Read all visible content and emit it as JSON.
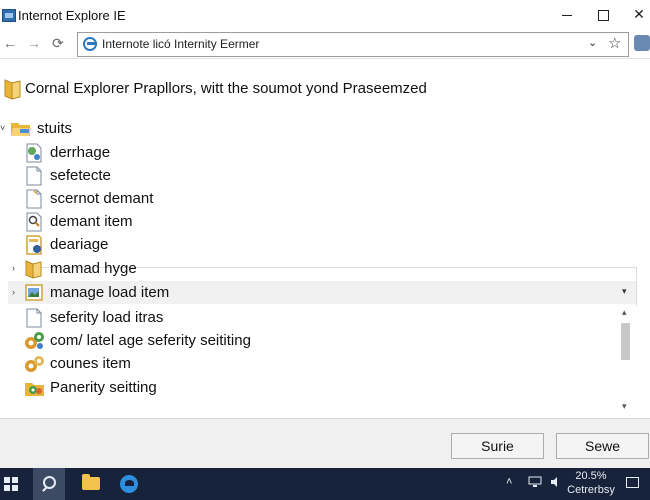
{
  "window": {
    "title": "Internot Explore IE",
    "controls": {
      "minimize": "minimize-icon",
      "maximize": "maximize-icon",
      "close": "close-icon"
    }
  },
  "address_bar": {
    "back": "←",
    "forward": "→",
    "refresh": "⟳",
    "url": "Internote licó Internity Eermer",
    "dropdown": "⌄",
    "favorite": "☆"
  },
  "header": {
    "text": "Cornal Explorer Prapllors, witt the soumot yond Praseemzed"
  },
  "tree": {
    "root": {
      "label": "stuits",
      "expander": "˅"
    },
    "items": [
      {
        "label": "derrhage",
        "icon": "settings-file-icon"
      },
      {
        "label": "sefetecte",
        "icon": "document-icon"
      },
      {
        "label": "scernot demant",
        "icon": "document-icon"
      },
      {
        "label": "demant item",
        "icon": "search-document-icon"
      },
      {
        "label": "deariage",
        "icon": "shield-document-icon"
      },
      {
        "label": "mamad hyge",
        "icon": "folder-icon",
        "expander": "›"
      },
      {
        "label": "manage load item",
        "icon": "image-document-icon",
        "expander": "›",
        "dropdown": "▾"
      },
      {
        "label": "seferity load itras",
        "icon": "document-icon"
      },
      {
        "label": "com/ latel age seferity seititing",
        "icon": "gears-icon"
      },
      {
        "label": "counes item",
        "icon": "gears-icon"
      },
      {
        "label": "Panerity seitting",
        "icon": "gears-folder-icon"
      }
    ]
  },
  "scrollbar": {
    "up": "▴",
    "down": "▾"
  },
  "dialog_buttons": {
    "primary": "Surie",
    "secondary": "Sewe"
  },
  "taskbar": {
    "tray_caret": "˄",
    "clock_time": "20.5%",
    "clock_date": "Cetrerbsy"
  },
  "colors": {
    "accent": "#2b79c2",
    "folder": "#f2c24e",
    "taskbar": "#16233a",
    "selection": "#f1f1f1"
  }
}
